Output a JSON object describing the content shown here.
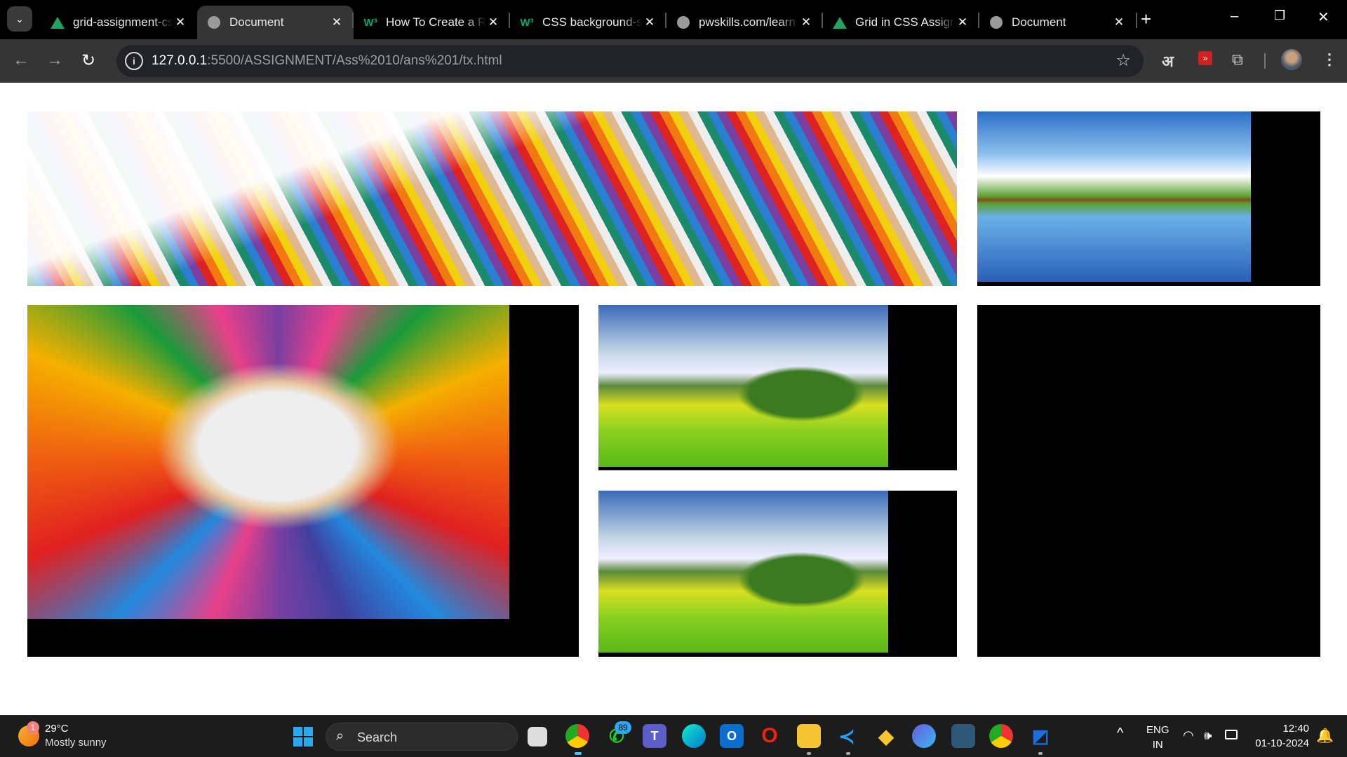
{
  "browser": {
    "tabs": [
      {
        "title": "grid-assignment-css",
        "icon": "google-drive-icon",
        "active": false
      },
      {
        "title": "Document",
        "icon": "globe-icon",
        "active": true
      },
      {
        "title": "How To Create a Responsive",
        "icon": "w3schools-icon",
        "active": false
      },
      {
        "title": "CSS background-size",
        "icon": "w3schools-icon",
        "active": false
      },
      {
        "title": "pwskills.com/learn",
        "icon": "globe-icon",
        "active": false
      },
      {
        "title": "Grid in CSS Assignment",
        "icon": "google-drive-icon",
        "active": false
      },
      {
        "title": "Document",
        "icon": "globe-icon",
        "active": false
      }
    ],
    "close_glyph": "✕",
    "new_tab": "+",
    "url_host": "127.0.0.1",
    "url_path": ":5500/ASSIGNMENT/Ass%2010/ans%201/tx.html",
    "translate_label": "अ"
  },
  "taskbar": {
    "weather_badge": "1",
    "temperature": "29°C",
    "weather": "Mostly sunny",
    "search_label": "Search",
    "whatsapp_badge": "89",
    "language": "ENG",
    "region": "IN",
    "time": "12:40",
    "date": "01-10-2024"
  }
}
